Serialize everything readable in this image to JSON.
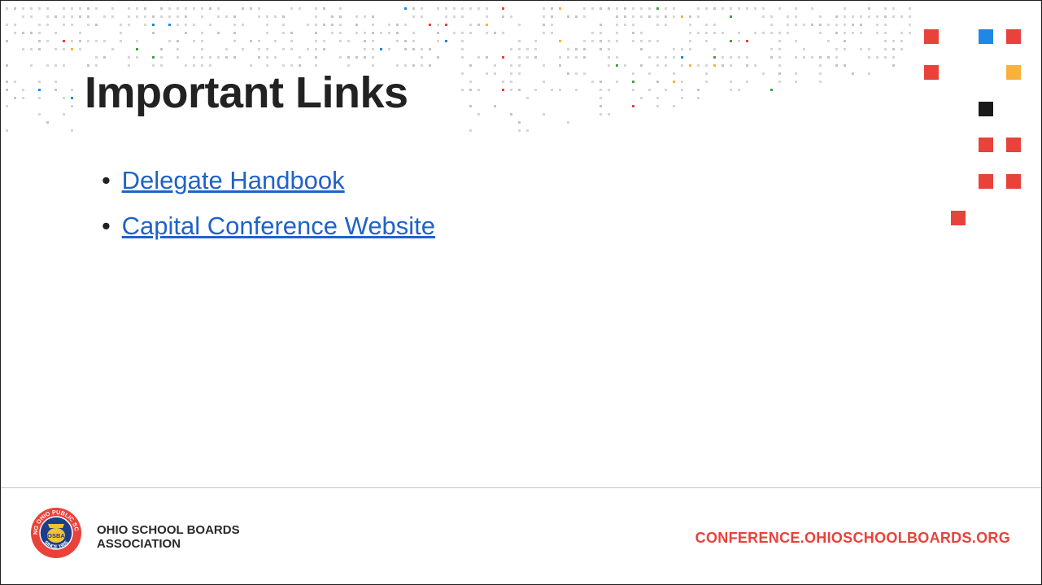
{
  "slide": {
    "title": "Important Links",
    "links": [
      {
        "label": "Delegate Handbook"
      },
      {
        "label": "Capital Conference Website"
      }
    ]
  },
  "footer": {
    "org_name_line1": "OHIO SCHOOL BOARDS",
    "org_name_line2": "ASSOCIATION",
    "site_url": "CONFERENCE.OHIOSCHOOLBOARDS.ORG",
    "logo": {
      "ring_text_top": "SERVING OHIO PUBLIC SCHOOLS",
      "ring_text_bottom": "SINCE 1955",
      "monogram": "OSBA"
    }
  },
  "colors": {
    "accent_red": "#e8423a",
    "accent_blue": "#1e88e5",
    "accent_yellow": "#f9b13d",
    "accent_black": "#1a1a1a",
    "link_blue": "#1f63c7",
    "logo_navy": "#1c3f8c",
    "logo_gold": "#f3c332"
  }
}
